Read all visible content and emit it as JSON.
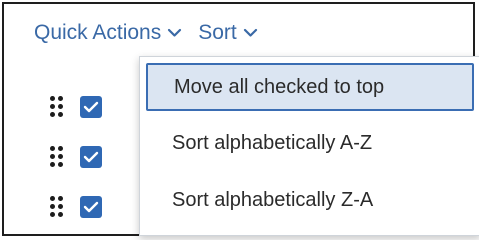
{
  "toolbar": {
    "quick_actions_label": "Quick Actions",
    "sort_label": "Sort"
  },
  "rows": [
    {
      "checked": true
    },
    {
      "checked": true
    },
    {
      "checked": true
    }
  ],
  "sort_menu": {
    "items": [
      {
        "label": "Move all checked to top",
        "highlighted": true
      },
      {
        "label": "Sort alphabetically A-Z",
        "highlighted": false
      },
      {
        "label": "Sort alphabetically Z-A",
        "highlighted": false
      }
    ]
  },
  "colors": {
    "accent": "#3a69a6",
    "checkbox": "#2f68b4",
    "highlight_bg": "#dbe5f2",
    "highlight_border": "#3a6db3"
  },
  "icons": {
    "dropdown_chevron": "chevron-down-icon",
    "drag_handle": "drag-handle-icon",
    "checkbox": "checkmark-icon"
  }
}
